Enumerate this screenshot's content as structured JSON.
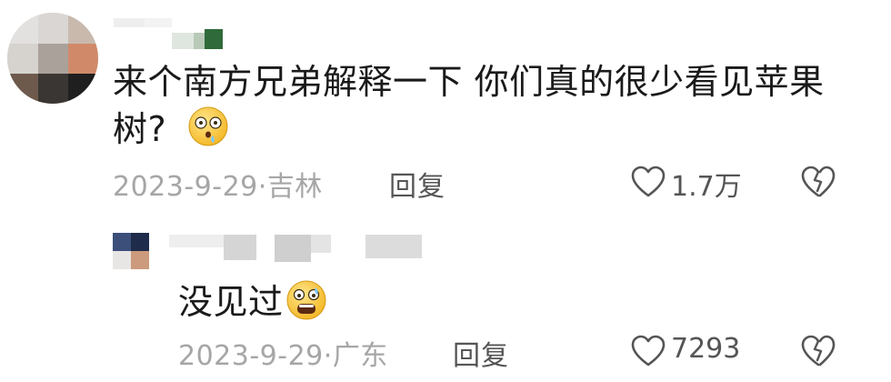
{
  "comments": [
    {
      "text_line1": "来个南方兄弟解释一下 你们真的很少看见苹果",
      "text_line2": "树?",
      "emoji": "shocked-drooling-face-emoji",
      "date": "2023-9-29",
      "location": "吉林",
      "reply_label": "回复",
      "like_count": "1.7万"
    },
    {
      "text": "没见过",
      "emoji": "crying-scared-face-emoji",
      "date": "2023-9-29",
      "location": "广东",
      "reply_label": "回复",
      "like_count": "7293"
    }
  ],
  "separator": "·",
  "icons": {
    "like": "heart-outline-icon",
    "dislike": "broken-heart-outline-icon"
  },
  "colors": {
    "text": "#1a1a1a",
    "meta": "#a6a6a6",
    "action": "#555555"
  }
}
